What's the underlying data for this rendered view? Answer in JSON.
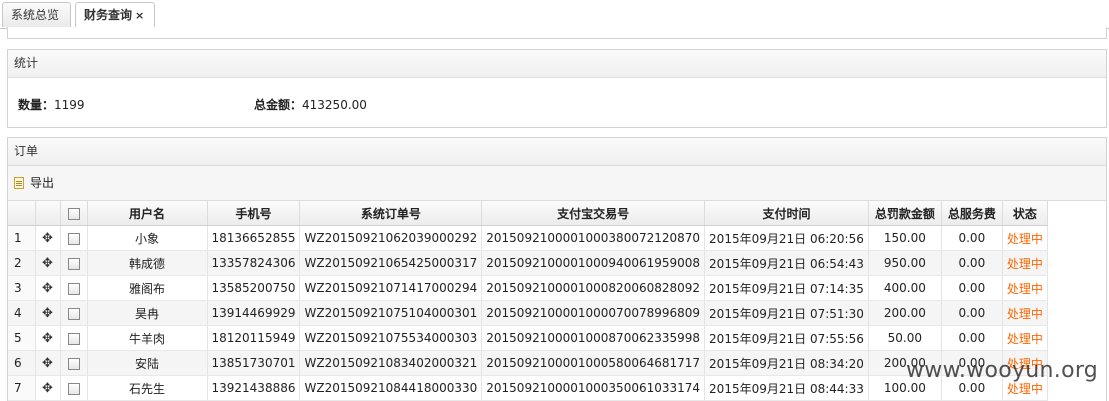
{
  "tabs": [
    {
      "label": "系统总览"
    },
    {
      "label": "财务查询",
      "close": "×"
    }
  ],
  "stats": {
    "title": "统计",
    "count_label": "数量：",
    "count_value": "1199",
    "amount_label": "总金额：",
    "amount_value": "413250.00"
  },
  "orders": {
    "title": "订单",
    "export_label": "导出",
    "columns": [
      "用户名",
      "手机号",
      "系统订单号",
      "支付宝交易号",
      "支付时间",
      "总罚款金额",
      "总服务费",
      "状态"
    ],
    "rows": [
      {
        "n": "1",
        "user": "小象",
        "phone": "18136652855",
        "order": "WZ20150921062039000292",
        "alipay": "2015092100001000380072120870",
        "time": "2015年09月21日 06:20:56",
        "fine": "150.00",
        "fee": "0.00",
        "status": "处理中"
      },
      {
        "n": "2",
        "user": "韩成德",
        "phone": "13357824306",
        "order": "WZ20150921065425000317",
        "alipay": "2015092100001000940061959008",
        "time": "2015年09月21日 06:54:43",
        "fine": "950.00",
        "fee": "0.00",
        "status": "处理中"
      },
      {
        "n": "3",
        "user": "雅阁布",
        "phone": "13585200750",
        "order": "WZ20150921071417000294",
        "alipay": "2015092100001000820060828092",
        "time": "2015年09月21日 07:14:35",
        "fine": "400.00",
        "fee": "0.00",
        "status": "处理中"
      },
      {
        "n": "4",
        "user": "昊冉",
        "phone": "13914469929",
        "order": "WZ20150921075104000301",
        "alipay": "2015092100001000070078996809",
        "time": "2015年09月21日 07:51:30",
        "fine": "200.00",
        "fee": "0.00",
        "status": "处理中"
      },
      {
        "n": "5",
        "user": "牛羊肉",
        "phone": "18120115949",
        "order": "WZ20150921075534000303",
        "alipay": "2015092100001000870062335998",
        "time": "2015年09月21日 07:55:56",
        "fine": "50.00",
        "fee": "0.00",
        "status": "处理中"
      },
      {
        "n": "6",
        "user": "安陆",
        "phone": "13851730701",
        "order": "WZ20150921083402000321",
        "alipay": "2015092100001000580064681717",
        "time": "2015年09月21日 08:34:20",
        "fine": "200.00",
        "fee": "0.00",
        "status": "处理中"
      },
      {
        "n": "7",
        "user": "石先生",
        "phone": "13921438886",
        "order": "WZ20150921084418000330",
        "alipay": "2015092100001000350061033174",
        "time": "2015年09月21日 08:44:33",
        "fine": "100.00",
        "fee": "0.00",
        "status": "处理中"
      }
    ]
  },
  "watermark": "www.wooyun.org",
  "colors": {
    "status": "#ff6600",
    "border": "#d3d3d3"
  }
}
